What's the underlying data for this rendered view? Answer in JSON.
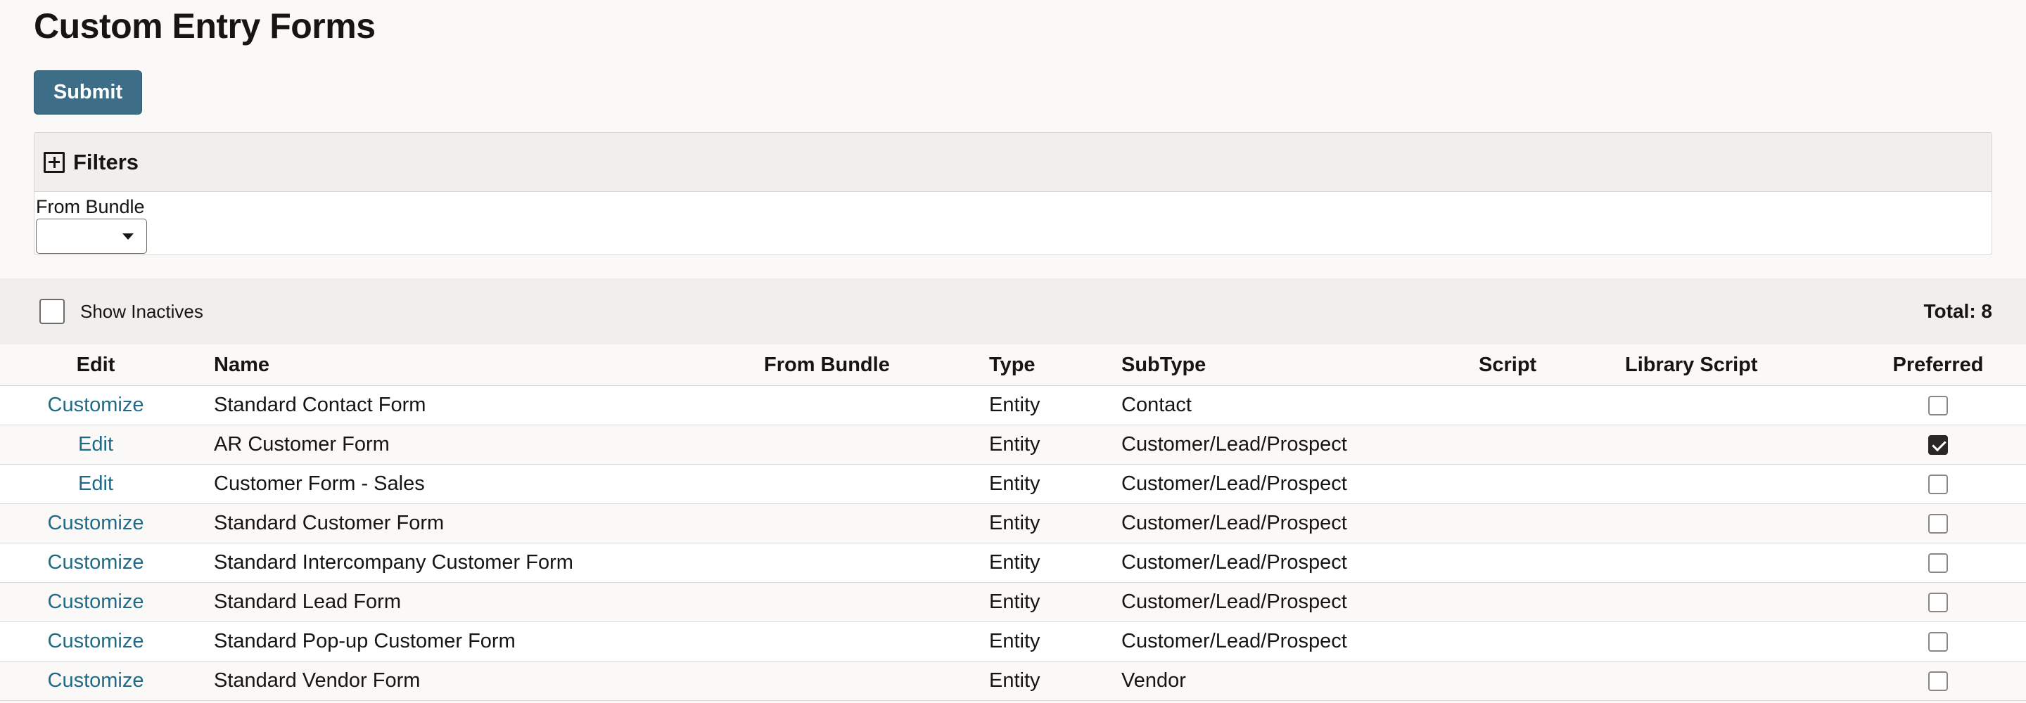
{
  "page": {
    "title": "Custom Entry Forms",
    "submit_label": "Submit"
  },
  "filters": {
    "header_label": "Filters",
    "expand_icon": "plus-square-icon",
    "from_bundle_label": "From Bundle",
    "from_bundle_value": ""
  },
  "toolbar": {
    "show_inactives_label": "Show Inactives",
    "show_inactives_checked": false,
    "total_label": "Total: 8"
  },
  "table": {
    "columns": [
      "Edit",
      "Name",
      "From Bundle",
      "Type",
      "SubType",
      "Script",
      "Library Script",
      "Preferred"
    ],
    "rows": [
      {
        "edit": "Customize",
        "name": "Standard Contact Form",
        "from_bundle": "",
        "type": "Entity",
        "subtype": "Contact",
        "script": "",
        "library_script": "",
        "preferred": false
      },
      {
        "edit": "Edit",
        "name": "AR Customer Form",
        "from_bundle": "",
        "type": "Entity",
        "subtype": "Customer/Lead/Prospect",
        "script": "",
        "library_script": "",
        "preferred": true
      },
      {
        "edit": "Edit",
        "name": "Customer Form - Sales",
        "from_bundle": "",
        "type": "Entity",
        "subtype": "Customer/Lead/Prospect",
        "script": "",
        "library_script": "",
        "preferred": false
      },
      {
        "edit": "Customize",
        "name": "Standard Customer Form",
        "from_bundle": "",
        "type": "Entity",
        "subtype": "Customer/Lead/Prospect",
        "script": "",
        "library_script": "",
        "preferred": false
      },
      {
        "edit": "Customize",
        "name": "Standard Intercompany Customer Form",
        "from_bundle": "",
        "type": "Entity",
        "subtype": "Customer/Lead/Prospect",
        "script": "",
        "library_script": "",
        "preferred": false
      },
      {
        "edit": "Customize",
        "name": "Standard Lead Form",
        "from_bundle": "",
        "type": "Entity",
        "subtype": "Customer/Lead/Prospect",
        "script": "",
        "library_script": "",
        "preferred": false
      },
      {
        "edit": "Customize",
        "name": "Standard Pop-up Customer Form",
        "from_bundle": "",
        "type": "Entity",
        "subtype": "Customer/Lead/Prospect",
        "script": "",
        "library_script": "",
        "preferred": false
      },
      {
        "edit": "Customize",
        "name": "Standard Vendor Form",
        "from_bundle": "",
        "type": "Entity",
        "subtype": "Vendor",
        "script": "",
        "library_script": "",
        "preferred": false
      }
    ]
  },
  "colors": {
    "accent_button": "#3e6d87",
    "link": "#1f6b86",
    "panel_header": "#f1efed",
    "page_background": "#faf9f8"
  }
}
